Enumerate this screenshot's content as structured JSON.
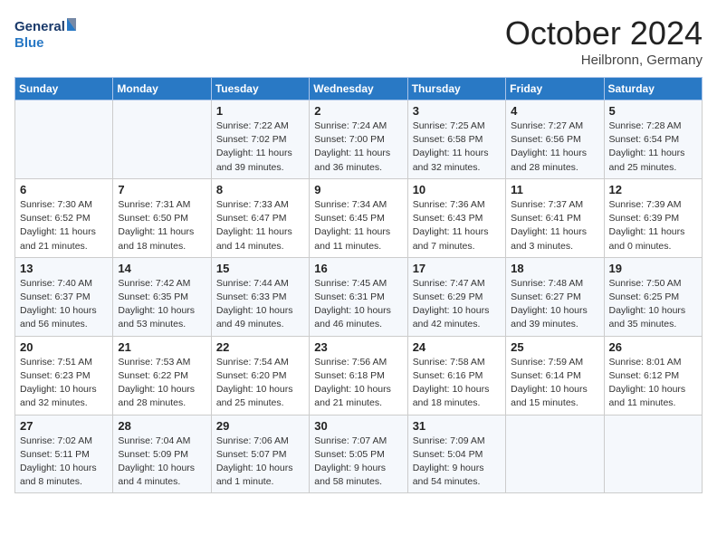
{
  "header": {
    "logo_general": "General",
    "logo_blue": "Blue",
    "month_title": "October 2024",
    "subtitle": "Heilbronn, Germany"
  },
  "weekdays": [
    "Sunday",
    "Monday",
    "Tuesday",
    "Wednesday",
    "Thursday",
    "Friday",
    "Saturday"
  ],
  "weeks": [
    [
      {
        "day": "",
        "info": ""
      },
      {
        "day": "",
        "info": ""
      },
      {
        "day": "1",
        "info": "Sunrise: 7:22 AM\nSunset: 7:02 PM\nDaylight: 11 hours and 39 minutes."
      },
      {
        "day": "2",
        "info": "Sunrise: 7:24 AM\nSunset: 7:00 PM\nDaylight: 11 hours and 36 minutes."
      },
      {
        "day": "3",
        "info": "Sunrise: 7:25 AM\nSunset: 6:58 PM\nDaylight: 11 hours and 32 minutes."
      },
      {
        "day": "4",
        "info": "Sunrise: 7:27 AM\nSunset: 6:56 PM\nDaylight: 11 hours and 28 minutes."
      },
      {
        "day": "5",
        "info": "Sunrise: 7:28 AM\nSunset: 6:54 PM\nDaylight: 11 hours and 25 minutes."
      }
    ],
    [
      {
        "day": "6",
        "info": "Sunrise: 7:30 AM\nSunset: 6:52 PM\nDaylight: 11 hours and 21 minutes."
      },
      {
        "day": "7",
        "info": "Sunrise: 7:31 AM\nSunset: 6:50 PM\nDaylight: 11 hours and 18 minutes."
      },
      {
        "day": "8",
        "info": "Sunrise: 7:33 AM\nSunset: 6:47 PM\nDaylight: 11 hours and 14 minutes."
      },
      {
        "day": "9",
        "info": "Sunrise: 7:34 AM\nSunset: 6:45 PM\nDaylight: 11 hours and 11 minutes."
      },
      {
        "day": "10",
        "info": "Sunrise: 7:36 AM\nSunset: 6:43 PM\nDaylight: 11 hours and 7 minutes."
      },
      {
        "day": "11",
        "info": "Sunrise: 7:37 AM\nSunset: 6:41 PM\nDaylight: 11 hours and 3 minutes."
      },
      {
        "day": "12",
        "info": "Sunrise: 7:39 AM\nSunset: 6:39 PM\nDaylight: 11 hours and 0 minutes."
      }
    ],
    [
      {
        "day": "13",
        "info": "Sunrise: 7:40 AM\nSunset: 6:37 PM\nDaylight: 10 hours and 56 minutes."
      },
      {
        "day": "14",
        "info": "Sunrise: 7:42 AM\nSunset: 6:35 PM\nDaylight: 10 hours and 53 minutes."
      },
      {
        "day": "15",
        "info": "Sunrise: 7:44 AM\nSunset: 6:33 PM\nDaylight: 10 hours and 49 minutes."
      },
      {
        "day": "16",
        "info": "Sunrise: 7:45 AM\nSunset: 6:31 PM\nDaylight: 10 hours and 46 minutes."
      },
      {
        "day": "17",
        "info": "Sunrise: 7:47 AM\nSunset: 6:29 PM\nDaylight: 10 hours and 42 minutes."
      },
      {
        "day": "18",
        "info": "Sunrise: 7:48 AM\nSunset: 6:27 PM\nDaylight: 10 hours and 39 minutes."
      },
      {
        "day": "19",
        "info": "Sunrise: 7:50 AM\nSunset: 6:25 PM\nDaylight: 10 hours and 35 minutes."
      }
    ],
    [
      {
        "day": "20",
        "info": "Sunrise: 7:51 AM\nSunset: 6:23 PM\nDaylight: 10 hours and 32 minutes."
      },
      {
        "day": "21",
        "info": "Sunrise: 7:53 AM\nSunset: 6:22 PM\nDaylight: 10 hours and 28 minutes."
      },
      {
        "day": "22",
        "info": "Sunrise: 7:54 AM\nSunset: 6:20 PM\nDaylight: 10 hours and 25 minutes."
      },
      {
        "day": "23",
        "info": "Sunrise: 7:56 AM\nSunset: 6:18 PM\nDaylight: 10 hours and 21 minutes."
      },
      {
        "day": "24",
        "info": "Sunrise: 7:58 AM\nSunset: 6:16 PM\nDaylight: 10 hours and 18 minutes."
      },
      {
        "day": "25",
        "info": "Sunrise: 7:59 AM\nSunset: 6:14 PM\nDaylight: 10 hours and 15 minutes."
      },
      {
        "day": "26",
        "info": "Sunrise: 8:01 AM\nSunset: 6:12 PM\nDaylight: 10 hours and 11 minutes."
      }
    ],
    [
      {
        "day": "27",
        "info": "Sunrise: 7:02 AM\nSunset: 5:11 PM\nDaylight: 10 hours and 8 minutes."
      },
      {
        "day": "28",
        "info": "Sunrise: 7:04 AM\nSunset: 5:09 PM\nDaylight: 10 hours and 4 minutes."
      },
      {
        "day": "29",
        "info": "Sunrise: 7:06 AM\nSunset: 5:07 PM\nDaylight: 10 hours and 1 minute."
      },
      {
        "day": "30",
        "info": "Sunrise: 7:07 AM\nSunset: 5:05 PM\nDaylight: 9 hours and 58 minutes."
      },
      {
        "day": "31",
        "info": "Sunrise: 7:09 AM\nSunset: 5:04 PM\nDaylight: 9 hours and 54 minutes."
      },
      {
        "day": "",
        "info": ""
      },
      {
        "day": "",
        "info": ""
      }
    ]
  ]
}
